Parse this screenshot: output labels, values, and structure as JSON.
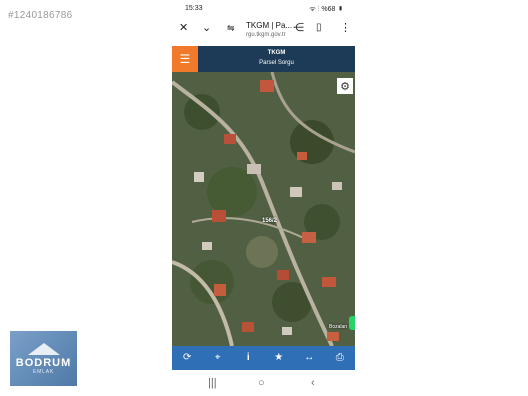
{
  "watermark": {
    "listing_id": "#1240186786"
  },
  "logo": {
    "name": "BODRUM",
    "subtitle": "EMLAK"
  },
  "status_bar": {
    "time": "15:33",
    "right": "ᯤ ⫶ %68 ▮"
  },
  "browser": {
    "page_title": "TKGM | Pa...",
    "url": "rgu.tkgm.gov.tr",
    "icons": [
      "close-icon",
      "chevron-down-icon",
      "tune-icon",
      "share-icon",
      "bookmark-icon",
      "more-vert-icon"
    ]
  },
  "app": {
    "title": "TKGM",
    "subtitle": "Parsel Sorgu"
  },
  "map": {
    "parcel_label": "156/2",
    "place_label": "Bozalan",
    "gear_icon": "settings-icon"
  },
  "toolbar": {
    "items": [
      "refresh-icon",
      "locate-icon",
      "info-icon",
      "favorite-icon",
      "measure-icon",
      "print-icon"
    ]
  },
  "nav": {
    "items": [
      "recent-apps-icon",
      "home-icon",
      "back-icon"
    ]
  }
}
